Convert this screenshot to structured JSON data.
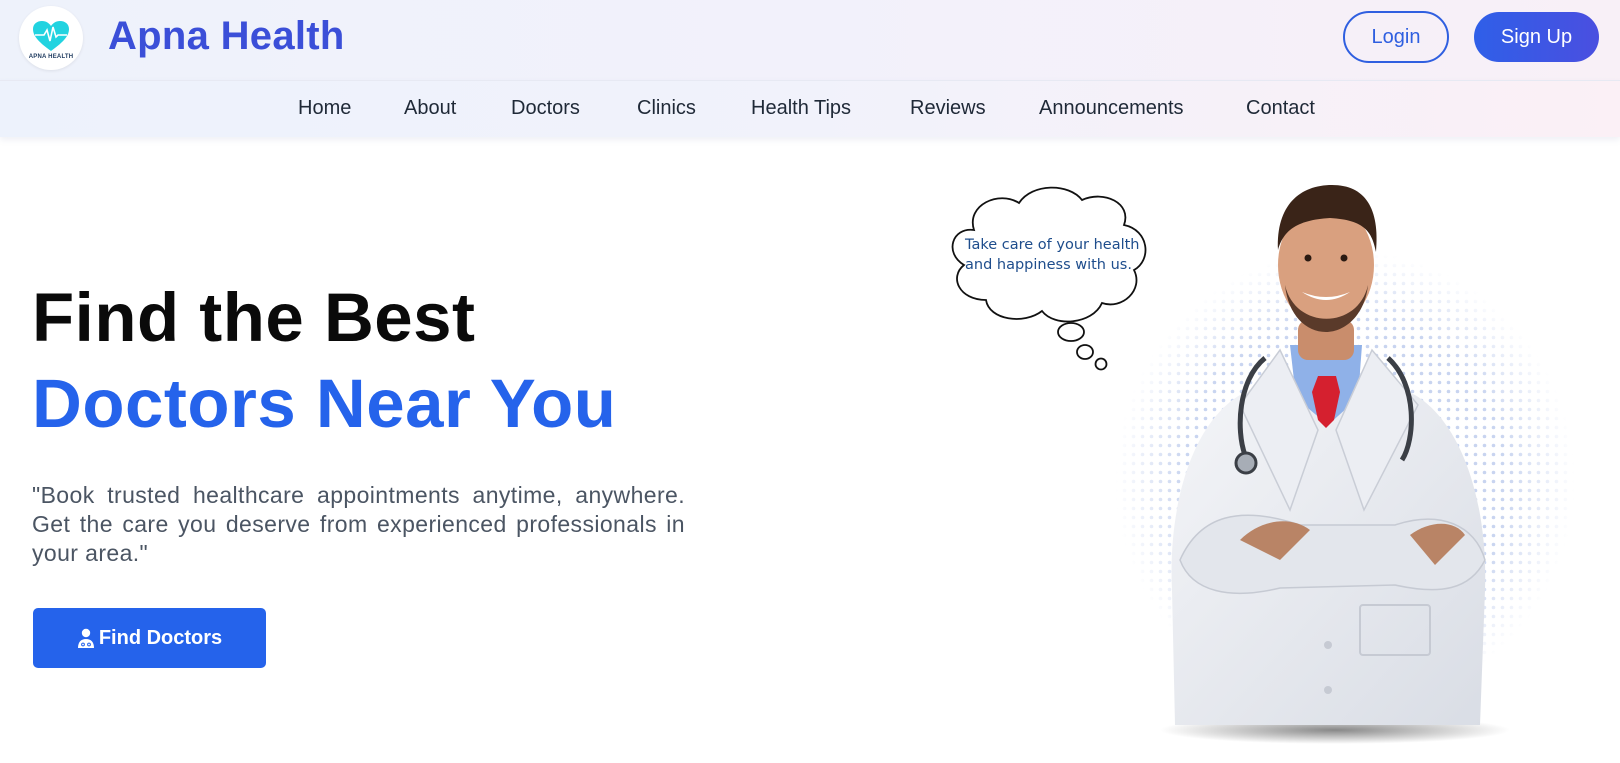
{
  "header": {
    "logo_text": "APNA HEALTH",
    "brand": "Apna Health",
    "login_label": "Login",
    "signup_label": "Sign Up"
  },
  "nav": {
    "items": [
      {
        "label": "Home"
      },
      {
        "label": "About"
      },
      {
        "label": "Doctors"
      },
      {
        "label": "Clinics"
      },
      {
        "label": "Health Tips"
      },
      {
        "label": "Reviews"
      },
      {
        "label": "Announcements"
      },
      {
        "label": "Contact"
      }
    ]
  },
  "hero": {
    "title_line1": "Find the Best",
    "title_line2": "Doctors Near You",
    "description": "\"Book trusted healthcare appointments anytime, anywhere. Get the care you deserve from experienced professionals in your area.\"",
    "cta_label": "Find Doctors",
    "cta_icon": "doctor-icon",
    "bubble_text": "Take care of your health and happiness with us."
  },
  "colors": {
    "brand": "#3b4fd8",
    "accent": "#2563eb",
    "heading": "#0a0a0a",
    "body_text": "#4b5563"
  }
}
